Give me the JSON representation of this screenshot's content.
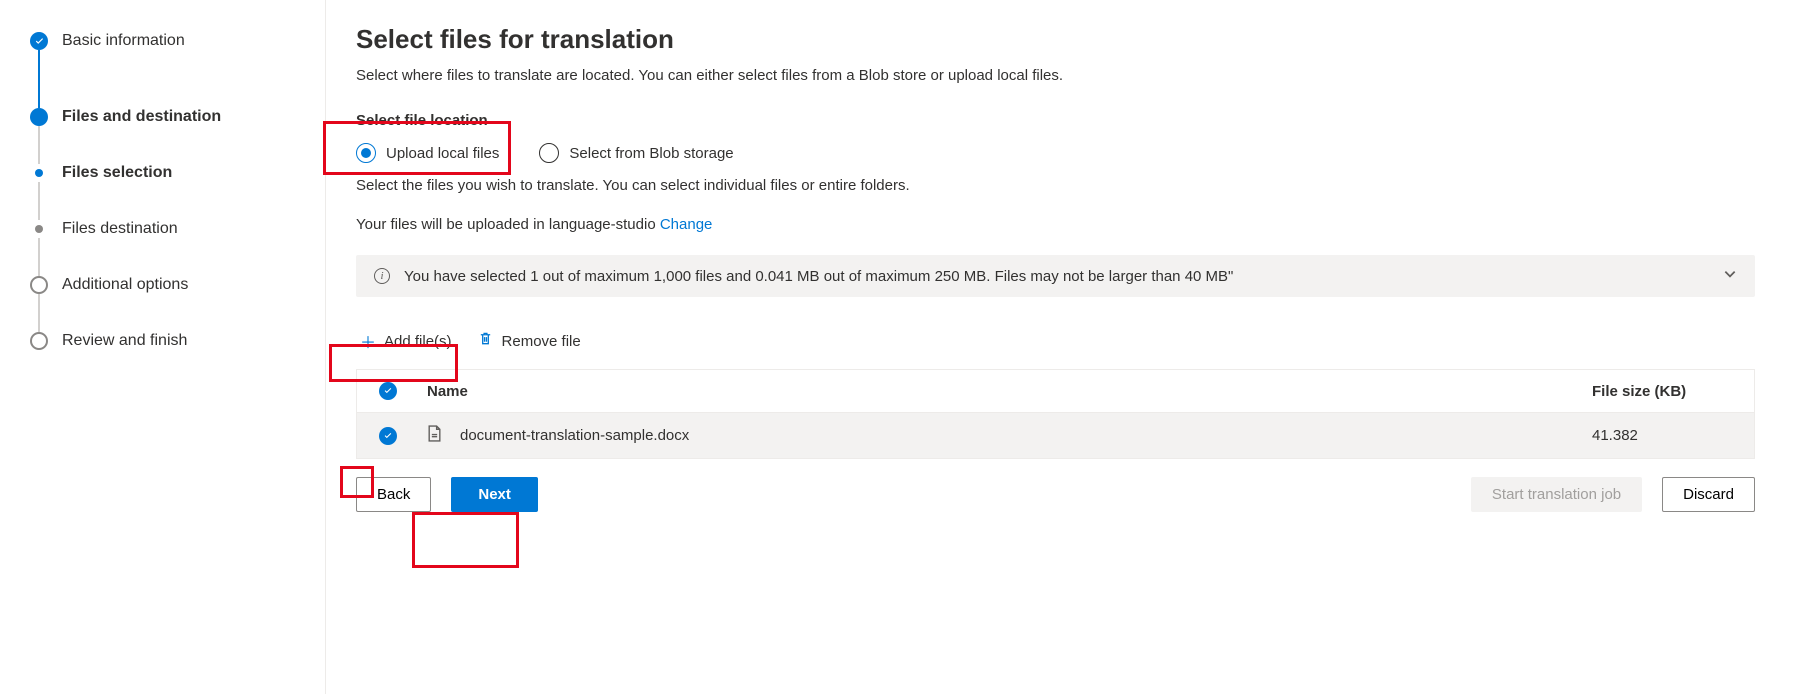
{
  "stepper": {
    "steps": [
      {
        "label": "Basic information",
        "state": "completed"
      },
      {
        "label": "Files and destination",
        "state": "active"
      },
      {
        "label": "Files selection",
        "state": "sub-active"
      },
      {
        "label": "Files destination",
        "state": "sub-upcoming"
      },
      {
        "label": "Additional options",
        "state": "upcoming"
      },
      {
        "label": "Review and finish",
        "state": "upcoming"
      }
    ]
  },
  "title": "Select files for translation",
  "description": "Select where files to translate are located. You can either select files from a Blob store or upload local files.",
  "file_location": {
    "label": "Select file location",
    "options": {
      "upload": "Upload local files",
      "blob": "Select from Blob storage"
    },
    "sub": "Select the files you wish to translate. You can select individual files or entire folders.",
    "upload_line_prefix": "Your files will be uploaded in language-studio ",
    "change": "Change"
  },
  "banner": "You have selected 1 out of maximum 1,000 files and 0.041 MB out of maximum 250 MB. Files may not be larger than 40 MB\"",
  "toolbar": {
    "add": "Add file(s)",
    "remove": "Remove file"
  },
  "table": {
    "head_name": "Name",
    "head_size": "File size (KB)",
    "rows": [
      {
        "name": "document-translation-sample.docx",
        "size": "41.382"
      }
    ]
  },
  "footer": {
    "back": "Back",
    "next": "Next",
    "start": "Start translation job",
    "discard": "Discard"
  }
}
